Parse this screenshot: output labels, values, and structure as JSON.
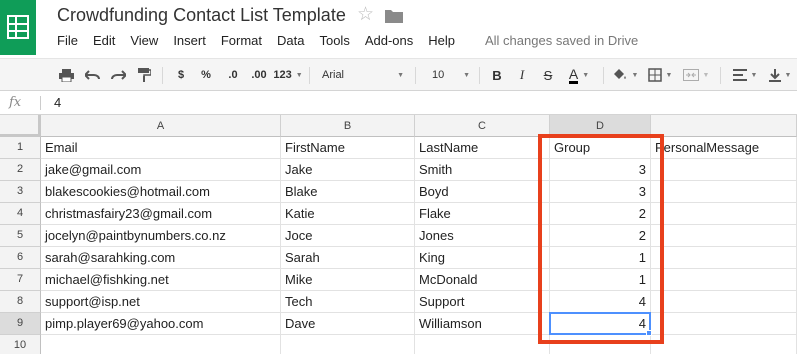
{
  "app": {
    "title": "Crowdfunding Contact List Template",
    "save_status": "All changes saved in Drive"
  },
  "menu": [
    "File",
    "Edit",
    "View",
    "Insert",
    "Format",
    "Data",
    "Tools",
    "Add-ons",
    "Help"
  ],
  "toolbar": {
    "currency": "$",
    "percent": "%",
    "decrease_decimals": ".0",
    "increase_decimals": ".00",
    "more_formats": "123",
    "font": "Arial",
    "font_size": "10",
    "bold": "B",
    "italic": "I",
    "strikethrough": "S",
    "text_color_glyph": "A"
  },
  "formula_bar": {
    "fx": "fx",
    "value": "4"
  },
  "sheet": {
    "columns": [
      "A",
      "B",
      "C",
      "D"
    ],
    "row_numbers": [
      "1",
      "2",
      "3",
      "4",
      "5",
      "6",
      "7",
      "8",
      "9",
      "10"
    ],
    "rows": [
      [
        "Email",
        "FirstName",
        "LastName",
        "Group",
        "PersonalMessage"
      ],
      [
        "jake@gmail.com",
        "Jake",
        "Smith",
        "3",
        ""
      ],
      [
        "blakescookies@hotmail.com",
        "Blake",
        "Boyd",
        "3",
        ""
      ],
      [
        "christmasfairy23@gmail.com",
        "Katie",
        "Flake",
        "2",
        ""
      ],
      [
        "jocelyn@paintbynumbers.co.nz",
        "Joce",
        "Jones",
        "2",
        ""
      ],
      [
        "sarah@sarahking.com",
        "Sarah",
        "King",
        "1",
        ""
      ],
      [
        "michael@fishking.net",
        "Mike",
        "McDonald",
        "1",
        ""
      ],
      [
        "support@isp.net",
        "Tech",
        "Support",
        "4",
        ""
      ],
      [
        "pimp.player69@yahoo.com",
        "Dave",
        "Williamson",
        "4",
        ""
      ],
      [
        "",
        "",
        "",
        "",
        ""
      ]
    ],
    "active_cell": "D9",
    "highlight_color": "#e8401c",
    "selection_color": "#4d90fe"
  }
}
